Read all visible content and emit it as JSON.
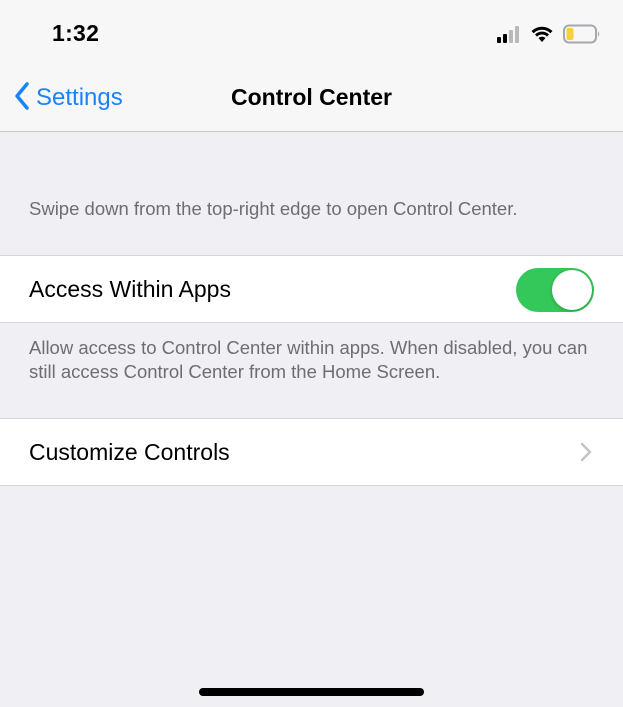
{
  "status_bar": {
    "time": "1:32",
    "icons": [
      "cellular-signal-icon",
      "wifi-icon",
      "battery-icon"
    ],
    "battery_color": "#f4d23a"
  },
  "nav": {
    "back_label": "Settings",
    "title": "Control Center",
    "accent_color": "#1a82fb"
  },
  "content": {
    "section_header": "Swipe down from the top-right edge to open Control Center.",
    "access_within_apps": {
      "label": "Access Within Apps",
      "toggle_on": true,
      "toggle_color": "#34c759"
    },
    "access_footer": "Allow access to Control Center within apps. When disabled, you can still access Control Center from the Home Screen.",
    "customize_controls": {
      "label": "Customize Controls",
      "icon": "chevron-right-icon"
    }
  }
}
